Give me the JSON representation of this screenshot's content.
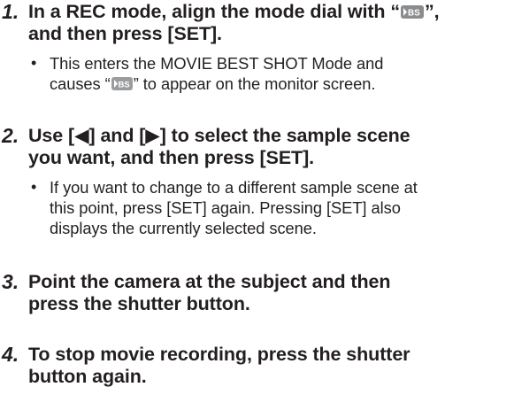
{
  "steps": [
    {
      "number": "1.",
      "heading_a": "In a REC mode, align the mode dial with “",
      "heading_b": "”,",
      "heading_c": "and then press [SET].",
      "bullet_a": "This enters the MOVIE BEST SHOT Mode and",
      "bullet_b": "causes “",
      "bullet_c": "” to appear on the monitor screen."
    },
    {
      "number": "2.",
      "heading_line1": "Use [◀] and [▶] to select the sample scene",
      "heading_line2": "you want, and then press [SET].",
      "bullet_line1": "If you want to change to a different sample scene at",
      "bullet_line2": "this point, press [SET] again. Pressing [SET] also",
      "bullet_line3": "displays the currently selected scene."
    },
    {
      "number": "3.",
      "heading_line1": "Point the camera at the subject and then",
      "heading_line2": "press the shutter button."
    },
    {
      "number": "4.",
      "heading_line1": "To stop movie recording, press the shutter",
      "heading_line2": "button again."
    }
  ],
  "icons": {
    "movie_bs": "movie-best-shot-icon",
    "bullet": "•"
  },
  "colors": {
    "text": "#231f20",
    "icon_fill": "#8a8c8e"
  }
}
